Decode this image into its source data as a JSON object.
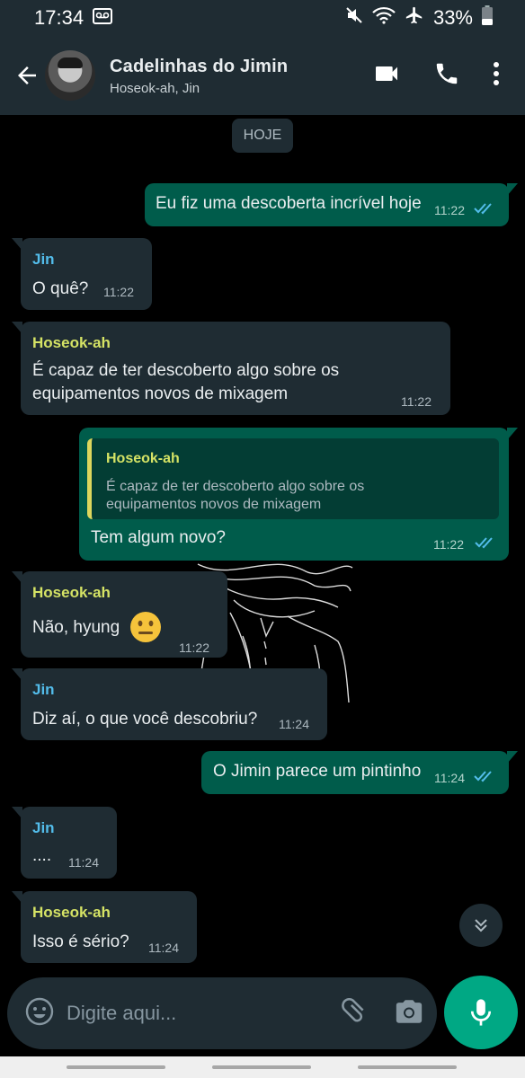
{
  "status_bar": {
    "time": "17:34",
    "battery": "33%"
  },
  "header": {
    "title": "Cadelinhas do Jimin",
    "subtitle": "Hoseok-ah, Jin"
  },
  "date_label": "HOJE",
  "colors": {
    "jin": "#53bdeb",
    "hoseok": "#d5e365",
    "accent": "#00a884",
    "read_ticks": "#53bdeb"
  },
  "messages": [
    {
      "direction": "out",
      "text": "Eu fiz uma descoberta incrível hoje",
      "time": "11:22",
      "read": true
    },
    {
      "direction": "in",
      "sender": "Jin",
      "text": "O quê?",
      "time": "11:22"
    },
    {
      "direction": "in",
      "sender": "Hoseok-ah",
      "lines": [
        "É capaz de ter descoberto algo sobre os",
        "equipamentos novos de mixagem"
      ],
      "time": "11:22"
    },
    {
      "direction": "out",
      "reply_to": {
        "sender": "Hoseok-ah",
        "lines": [
          "É capaz de ter descoberto algo sobre os",
          "equipamentos novos de mixagem"
        ]
      },
      "text": "Tem algum novo?",
      "time": "11:22",
      "read": true
    },
    {
      "direction": "in",
      "sender": "Hoseok-ah",
      "text": "Não, hyung",
      "emoji": "neutral-face",
      "time": "11:22"
    },
    {
      "direction": "in",
      "sender": "Jin",
      "text": "Diz aí, o que você descobriu?",
      "time": "11:24"
    },
    {
      "direction": "out",
      "text": "O Jimin parece um pintinho",
      "time": "11:24",
      "read": true
    },
    {
      "direction": "in",
      "sender": "Jin",
      "text": "....",
      "time": "11:24"
    },
    {
      "direction": "in",
      "sender": "Hoseok-ah",
      "text": "Isso é sério?",
      "time": "11:24"
    }
  ],
  "composer": {
    "placeholder": "Digite aqui..."
  }
}
